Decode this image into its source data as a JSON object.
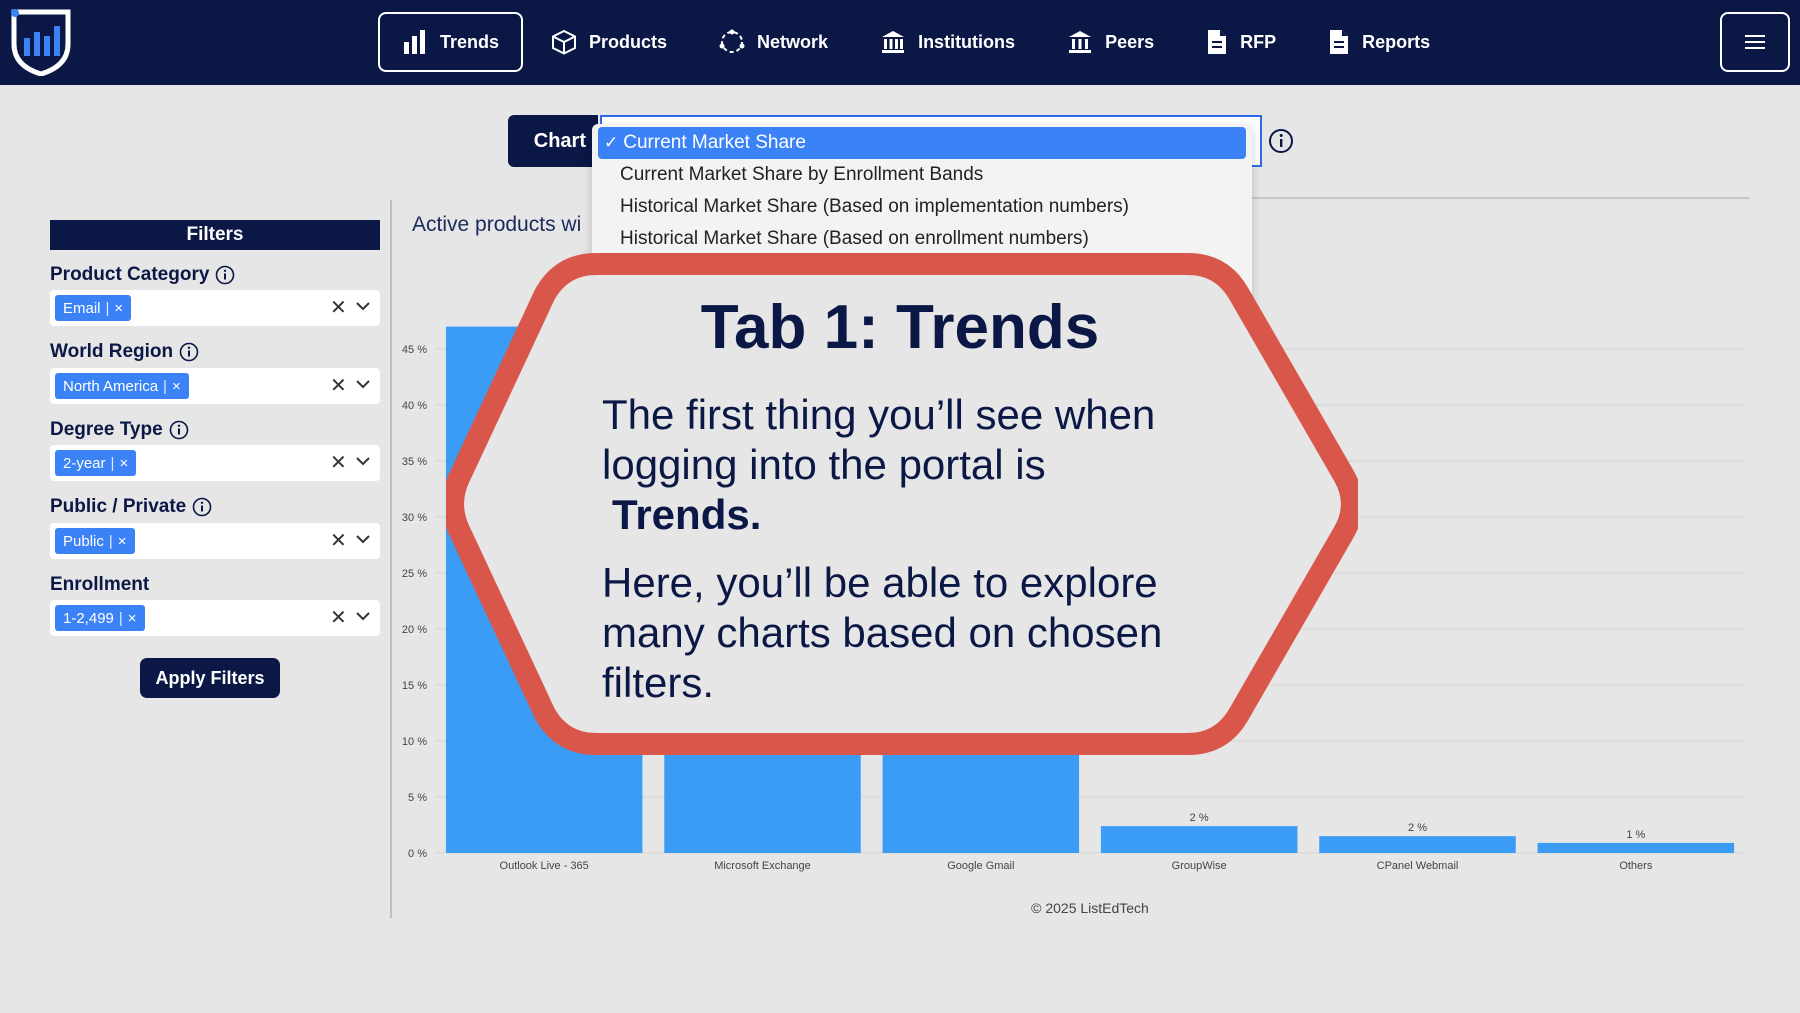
{
  "nav": {
    "items": [
      {
        "label": "Trends",
        "icon": "bar-chart-icon",
        "active": true
      },
      {
        "label": "Products",
        "icon": "cube-icon",
        "active": false
      },
      {
        "label": "Network",
        "icon": "network-icon",
        "active": false
      },
      {
        "label": "Institutions",
        "icon": "institution-icon",
        "active": false
      },
      {
        "label": "Peers",
        "icon": "peers-icon",
        "active": false
      },
      {
        "label": "RFP",
        "icon": "document-icon",
        "active": false
      },
      {
        "label": "Reports",
        "icon": "report-icon",
        "active": false
      }
    ],
    "menu_icon": "hamburger-icon"
  },
  "chart_selector": {
    "label": "Chart",
    "options": [
      "Current Market Share",
      "Current Market Share by Enrollment Bands",
      "Historical Market Share (Based on implementation numbers)",
      "Historical Market Share (Based on enrollment numbers)"
    ],
    "selected_index": 0,
    "check": "✓"
  },
  "filters": {
    "title": "Filters",
    "groups": [
      {
        "label": "Product Category",
        "has_info": true,
        "tag": "Email"
      },
      {
        "label": "World Region",
        "has_info": true,
        "tag": "North America"
      },
      {
        "label": "Degree Type",
        "has_info": true,
        "tag": "2-year"
      },
      {
        "label": "Public / Private",
        "has_info": true,
        "tag": "Public"
      },
      {
        "label": "Enrollment",
        "has_info": false,
        "tag": "1-2,499"
      }
    ],
    "tag_separator": "|",
    "tag_remove": "×",
    "clear": "✕",
    "apply_label": "Apply Filters"
  },
  "chart_title": "Active products wi",
  "chart_data": {
    "type": "bar",
    "categories": [
      "Outlook Live - 365",
      "Microsoft Exchange",
      "Google Gmail",
      "GroupWise",
      "CPanel Webmail",
      "Others"
    ],
    "values": [
      47,
      30,
      30,
      2.4,
      1.5,
      0.9
    ],
    "value_labels": [
      "47 %",
      "",
      "",
      "2 %",
      "2 %",
      "1 %"
    ],
    "yticks": [
      "0 %",
      "5 %",
      "10 %",
      "15 %",
      "20 %",
      "25 %",
      "30 %",
      "35 %",
      "40 %",
      "45 %"
    ],
    "ylim": [
      0,
      50
    ],
    "grid": true,
    "color": "#3b9cf5"
  },
  "footer": "© 2025 ListEdTech",
  "callout": {
    "title": "Tab 1: Trends",
    "p1_text": "The first thing you’ll see when logging into the portal is",
    "p1_bold": "Trends.",
    "p2_text": "Here, you’ll be able to explore many charts based on chosen filters.",
    "border_color": "#d9574a"
  },
  "colors": {
    "navy": "#0b1846",
    "accent": "#3b82f6"
  }
}
